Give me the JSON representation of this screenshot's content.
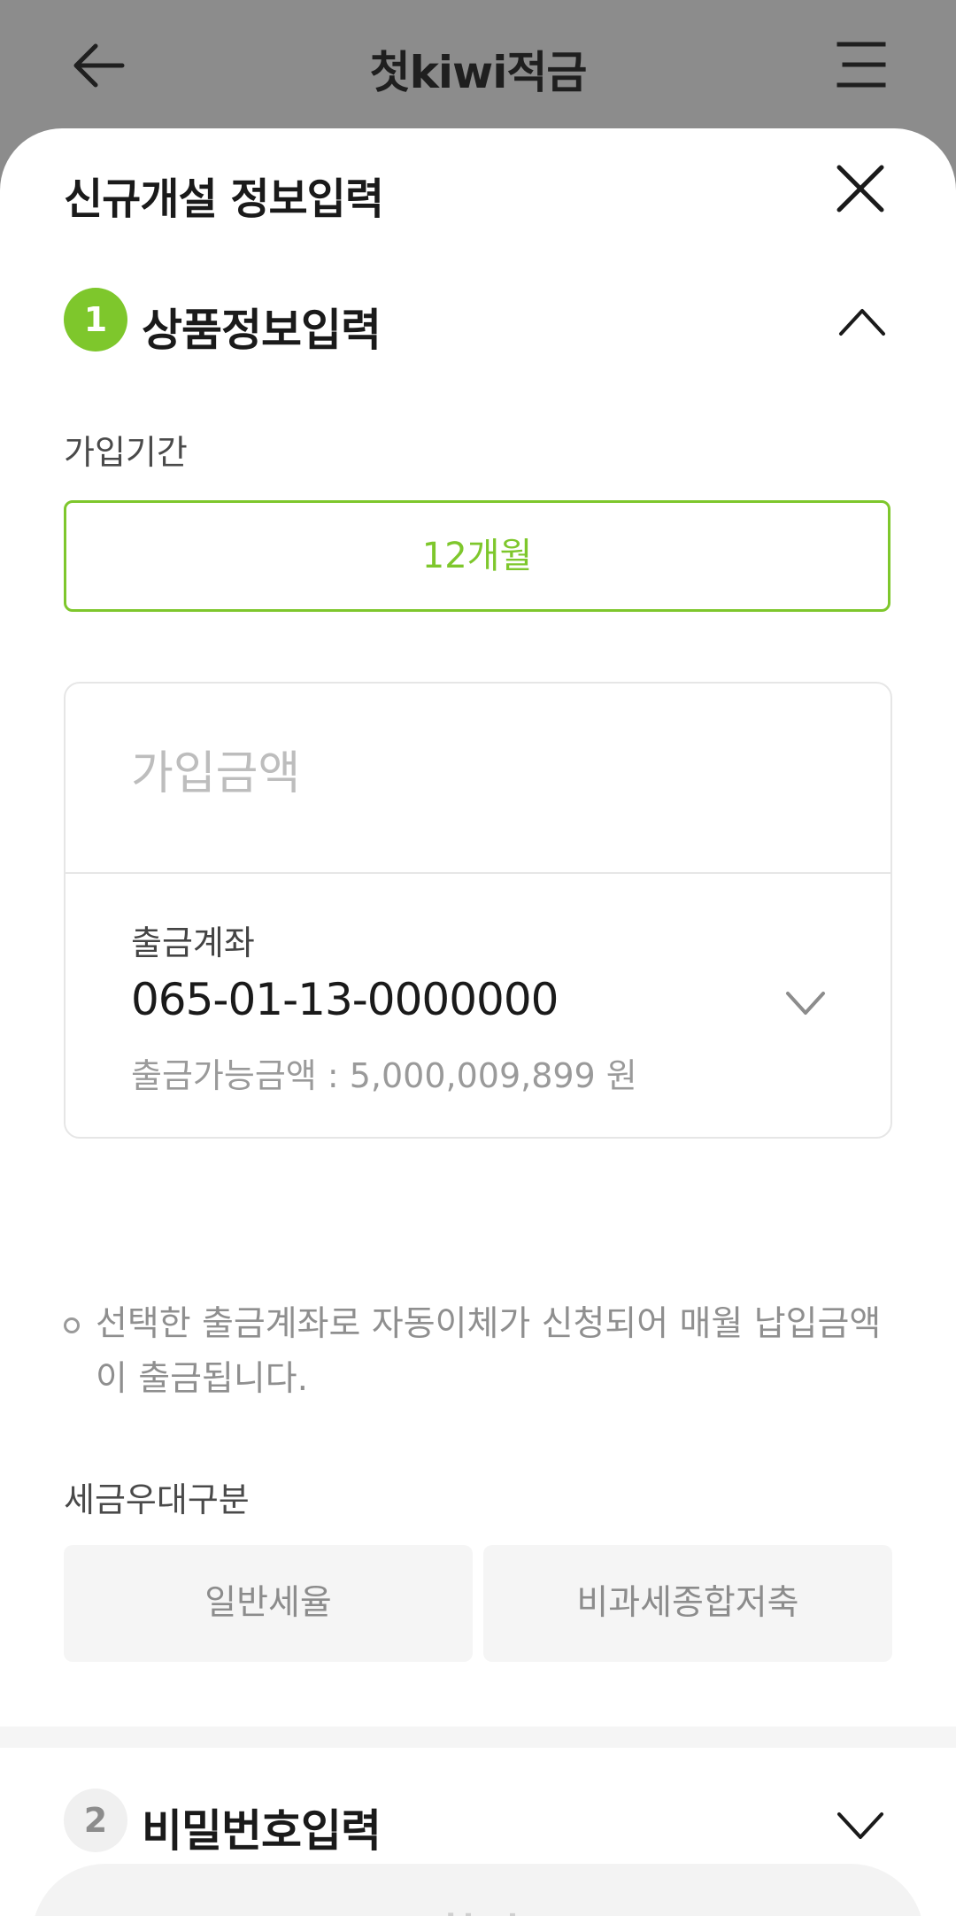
{
  "header": {
    "title": "첫kiwi적금"
  },
  "sheet": {
    "title": "신규개설 정보입력"
  },
  "step1": {
    "number": "1",
    "title": "상품정보입력"
  },
  "period": {
    "label": "가입기간",
    "value": "12개월"
  },
  "amount": {
    "placeholder": "가입금액"
  },
  "account": {
    "label": "출금계좌",
    "number": "065-01-13-0000000",
    "balance": "출금가능금액 : 5,000,009,899 원"
  },
  "notice": {
    "text": "선택한 출금계좌로 자동이체가 신청되어 매월 납입금액이 출금됩니다."
  },
  "tax": {
    "label": "세금우대구분",
    "options": [
      "일반세율",
      "비과세종합저축"
    ]
  },
  "step2": {
    "number": "2",
    "title": "비밀번호입력"
  },
  "confirm": {
    "label": "확인"
  },
  "colors": {
    "accent": "#7ec72c",
    "overlay": "#8c8c8c",
    "disabled_text": "#cfcfcf"
  },
  "icons": [
    "arrow-left-icon",
    "menu-icon",
    "close-icon",
    "chevron-up-icon",
    "chevron-down-icon"
  ]
}
